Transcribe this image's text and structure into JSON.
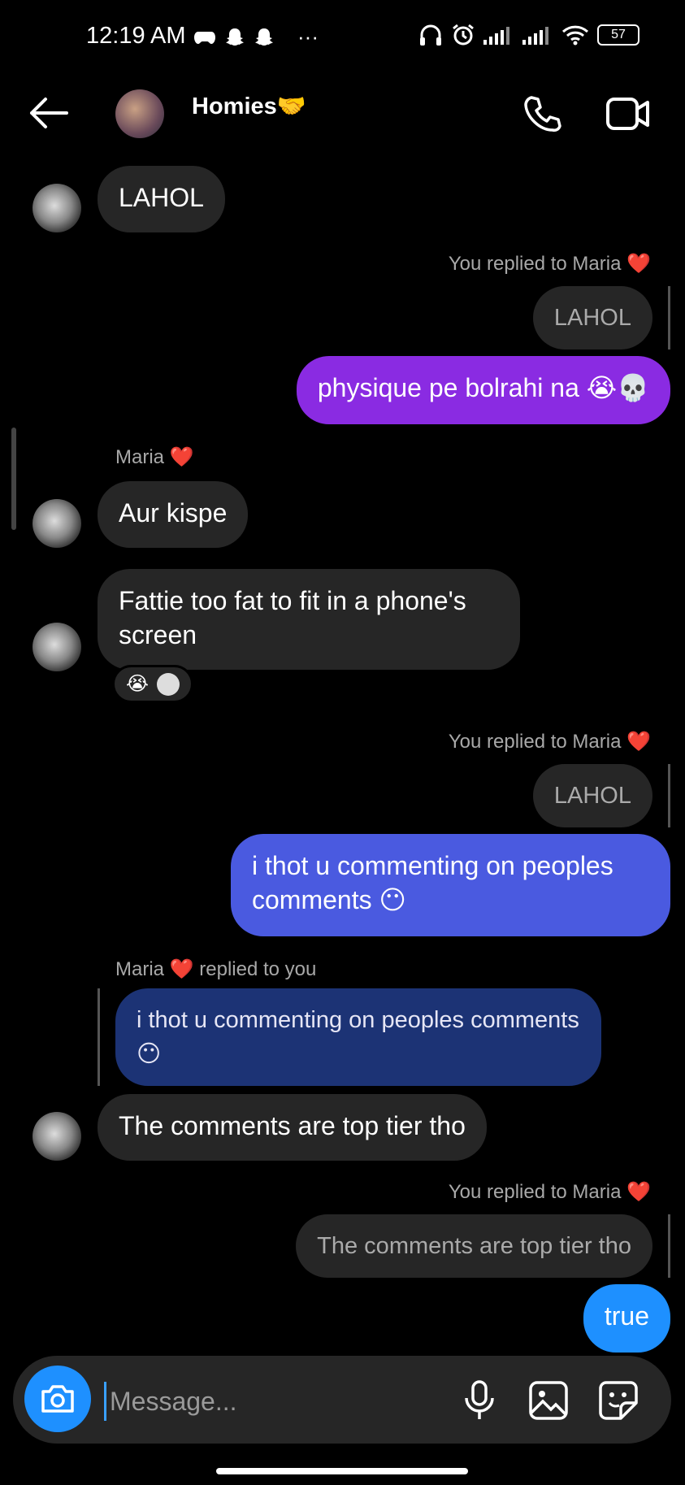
{
  "status_bar": {
    "time": "12:19 AM",
    "more": "···",
    "battery": "57",
    "left_icons": [
      "game-controller-icon",
      "snapchat-icon",
      "snapchat-icon"
    ],
    "right_icons": [
      "headphones-icon",
      "alarm-icon",
      "signal-icon",
      "signal-icon",
      "wifi-icon",
      "battery-icon"
    ]
  },
  "header": {
    "title": "Homies🤝",
    "icons": [
      "back-arrow-icon",
      "phone-icon",
      "video-camera-icon"
    ]
  },
  "messages": {
    "m1_text": "LAHOL",
    "m2_meta_prefix": "You replied to Maria",
    "m2_reply_quote": "LAHOL",
    "m2_text": "physique pe bolrahi na 😭💀",
    "m3_sender": "Maria",
    "m3_text": "Aur kispe",
    "m4_text": "Fattie too fat to fit in a phone's screen",
    "m4_reaction_emoji": "😭",
    "m5_meta_prefix": "You replied to Maria",
    "m5_reply_quote": "LAHOL",
    "m5_text": "i thot u commenting on peoples comments 😶",
    "m6_meta_sender": "Maria",
    "m6_meta_suffix": "replied to you",
    "m6_reply_quote": "i thot u commenting on peoples comments 😶",
    "m6_text": "The comments are top tier tho",
    "m7_meta_prefix": "You replied to Maria",
    "m7_reply_quote": "The comments are top tier tho",
    "m7_text": "true",
    "heart": "❤️"
  },
  "composer": {
    "placeholder": "Message...",
    "icons": [
      "camera-icon",
      "microphone-icon",
      "gallery-icon",
      "sticker-icon"
    ]
  },
  "colors": {
    "background": "#000000",
    "incoming_bubble": "#262626",
    "outgoing_purple": "#8a2be2",
    "outgoing_blue": "#4a5ae0",
    "quoted_blue": "#1c3375",
    "outgoing_light_blue": "#1e90ff",
    "heart": "#e0245e"
  }
}
